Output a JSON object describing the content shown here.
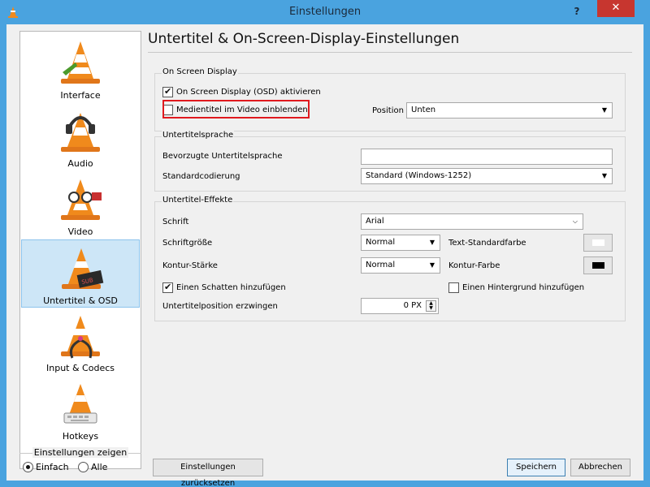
{
  "window": {
    "title": "Einstellungen",
    "help": "?",
    "close": "✕"
  },
  "sidebar": {
    "items": [
      {
        "label": "Interface",
        "icon": "cone-interface-icon"
      },
      {
        "label": "Audio",
        "icon": "cone-headphones-icon"
      },
      {
        "label": "Video",
        "icon": "cone-glasses-icon"
      },
      {
        "label": "Untertitel & OSD",
        "icon": "cone-subtitles-icon",
        "selected": true
      },
      {
        "label": "Input & Codecs",
        "icon": "cone-cable-icon"
      },
      {
        "label": "Hotkeys",
        "icon": "cone-keyboard-icon"
      }
    ]
  },
  "show_settings": {
    "legend": "Einstellungen zeigen",
    "simple": "Einfach",
    "all": "Alle",
    "selected": "Einfach"
  },
  "page": {
    "title": "Untertitel & On-Screen-Display-Einstellungen"
  },
  "osd": {
    "group_title": "On Screen Display",
    "enable_label": "On Screen Display (OSD) aktivieren",
    "enable_checked": true,
    "media_title_label": "Medientitel im Video einblenden",
    "media_title_checked": false,
    "position_label": "Position",
    "position_value": "Unten"
  },
  "subtitle_language": {
    "group_title": "Untertitelsprache",
    "preferred_label": "Bevorzugte Untertitelsprache",
    "preferred_value": "",
    "encoding_label": "Standardcodierung",
    "encoding_value": "Standard (Windows-1252)"
  },
  "effects": {
    "group_title": "Untertitel-Effekte",
    "font_label": "Schrift",
    "font_value": "Arial",
    "font_size_label": "Schriftgröße",
    "font_size_value": "Normal",
    "text_color_label": "Text-Standardfarbe",
    "text_color": "#ffffff",
    "outline_label": "Kontur-Stärke",
    "outline_value": "Normal",
    "outline_color_label": "Kontur-Farbe",
    "outline_color": "#000000",
    "shadow_label": "Einen Schatten hinzufügen",
    "shadow_checked": true,
    "background_label": "Einen Hintergrund hinzufügen",
    "background_checked": false,
    "force_position_label": "Untertitelposition erzwingen",
    "force_position_value": "0 PX"
  },
  "buttons": {
    "reset": "Einstellungen zurücksetzen",
    "save": "Speichern",
    "cancel": "Abbrechen"
  },
  "colors": {
    "titlebar": "#4aa3df",
    "close": "#c7362f",
    "highlight": "#e0191e",
    "selected_item": "#cde6f7"
  }
}
